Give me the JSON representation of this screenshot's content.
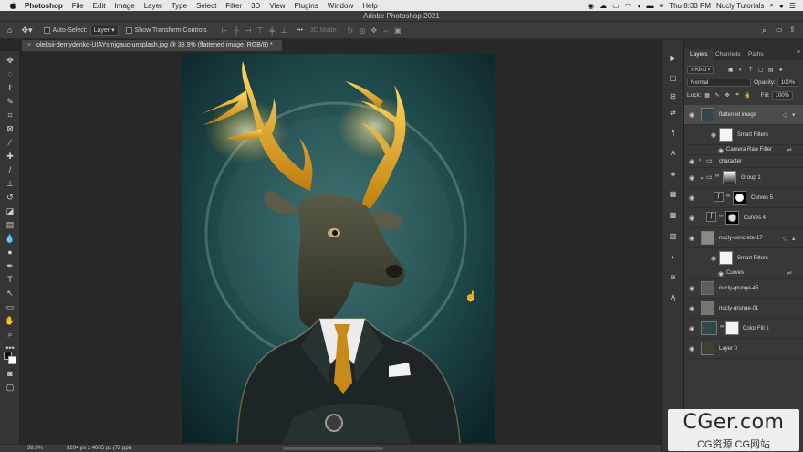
{
  "menubar": {
    "app": "Photoshop",
    "items": [
      "File",
      "Edit",
      "Image",
      "Layer",
      "Type",
      "Select",
      "Filter",
      "3D",
      "View",
      "Plugins",
      "Window",
      "Help"
    ],
    "clock": "Thu 8:33 PM",
    "user": "Nucly Tutorials"
  },
  "titlebar": {
    "title": "Adobe Photoshop 2021"
  },
  "options": {
    "auto_select_label": "Auto-Select:",
    "auto_select_value": "Layer",
    "transform_label": "Show Transform Controls",
    "mode_label": "3D Mode:"
  },
  "document": {
    "tab_title": "oleksii-demydenko-UIAYsmjgauc-unsplash.jpg @ 38.9% (flattened image, RGB/8) *"
  },
  "status": {
    "zoom": "38.9%",
    "dimensions": "3204 px x 4005 px (72 ppi)"
  },
  "panels": {
    "tabs": [
      "Layers",
      "Channels",
      "Paths"
    ],
    "kind_label": "Kind",
    "blend_mode": "Normal",
    "opacity_label": "Opacity:",
    "opacity_value": "100%",
    "lock_label": "Lock:",
    "fill_label": "Fill:",
    "fill_value": "100%"
  },
  "layers": [
    {
      "name": "flattened image"
    },
    {
      "name": "Smart Filters"
    },
    {
      "name": "Camera Raw Filter"
    },
    {
      "name": "character"
    },
    {
      "name": "Group 1"
    },
    {
      "name": "Curves 5"
    },
    {
      "name": "Curves 4"
    },
    {
      "name": "nucly-concrete-17"
    },
    {
      "name": "Smart Filters"
    },
    {
      "name": "Curves"
    },
    {
      "name": "nucly-grunge-45"
    },
    {
      "name": "nucly-grunge-01"
    },
    {
      "name": "Color Fill 1"
    },
    {
      "name": "Layer 0"
    }
  ],
  "watermark": {
    "main": "CGer.com",
    "sub": "CG资源 CG网站"
  },
  "colors": {
    "background": "#282828",
    "panel": "#383838",
    "canvas_teal": "#1f4a4c",
    "antler_gold": "#e3a51c",
    "tie_orange": "#c98a1c"
  }
}
